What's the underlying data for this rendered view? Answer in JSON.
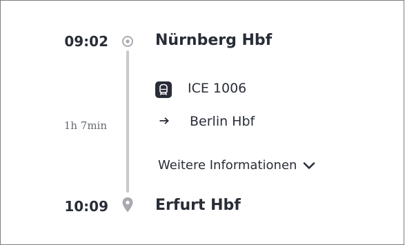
{
  "departure": {
    "time": "09:02",
    "station": "Nürnberg Hbf",
    "icon": "circle-dot-icon"
  },
  "arrival": {
    "time": "10:09",
    "station": "Erfurt Hbf",
    "icon": "location-pin-icon"
  },
  "leg": {
    "duration": "1h 7min",
    "train_icon": "ice-train-icon",
    "train_name": "ICE 1006",
    "direction_icon": "arrow-right-icon",
    "direction": "Berlin Hbf",
    "more_info_label": "Weitere Informationen",
    "more_info_icon": "chevron-down-icon"
  },
  "colors": {
    "text": "#282d37",
    "muted_text": "#646973",
    "route_line": "#c8c9cd",
    "border": "#7d7d7d"
  }
}
